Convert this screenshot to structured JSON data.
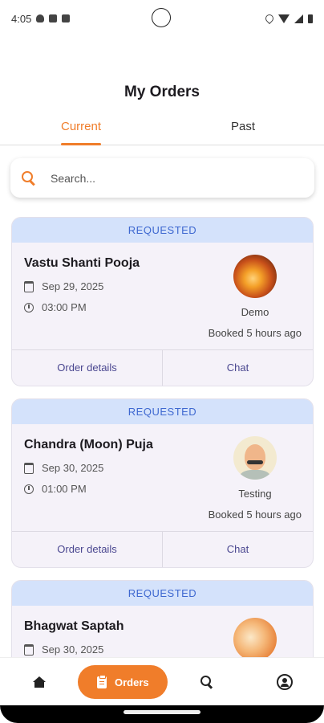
{
  "status_bar": {
    "time": "4:05",
    "left_icons": [
      "shield-icon",
      "sim-icon",
      "storage-icon"
    ],
    "right_icons": [
      "location-icon",
      "wifi-icon",
      "signal-icon",
      "battery-icon"
    ]
  },
  "header": {
    "title": "My Orders"
  },
  "tabs": [
    {
      "label": "Current",
      "active": true
    },
    {
      "label": "Past",
      "active": false
    }
  ],
  "search": {
    "placeholder": "Search...",
    "value": "",
    "icon": "search-icon"
  },
  "orders": [
    {
      "status": "REQUESTED",
      "service": "Vastu Shanti Pooja",
      "date": "Sep 29, 2025",
      "time": "03:00 PM",
      "priest": "Demo",
      "booked": "Booked 5 hours ago",
      "actions": [
        "Order details",
        "Chat"
      ]
    },
    {
      "status": "REQUESTED",
      "service": "Chandra (Moon) Puja",
      "date": "Sep 30, 2025",
      "time": "01:00 PM",
      "priest": "Testing",
      "booked": "Booked 5 hours ago",
      "actions": [
        "Order details",
        "Chat"
      ]
    },
    {
      "status": "REQUESTED",
      "service": "Bhagwat Saptah",
      "date": "Sep 30, 2025",
      "time": "",
      "priest": "",
      "booked": "",
      "actions": []
    }
  ],
  "bottom_nav": {
    "items": [
      {
        "icon": "home-icon",
        "label": ""
      },
      {
        "icon": "clipboard-icon",
        "label": "Orders",
        "active": true
      },
      {
        "icon": "search-icon",
        "label": ""
      },
      {
        "icon": "profile-icon",
        "label": ""
      }
    ]
  },
  "colors": {
    "accent": "#f07d2a",
    "status_banner_bg": "#d4e2fb",
    "status_banner_text": "#3e68d0",
    "card_bg": "#f5f2f9",
    "action_text": "#4a4790"
  }
}
